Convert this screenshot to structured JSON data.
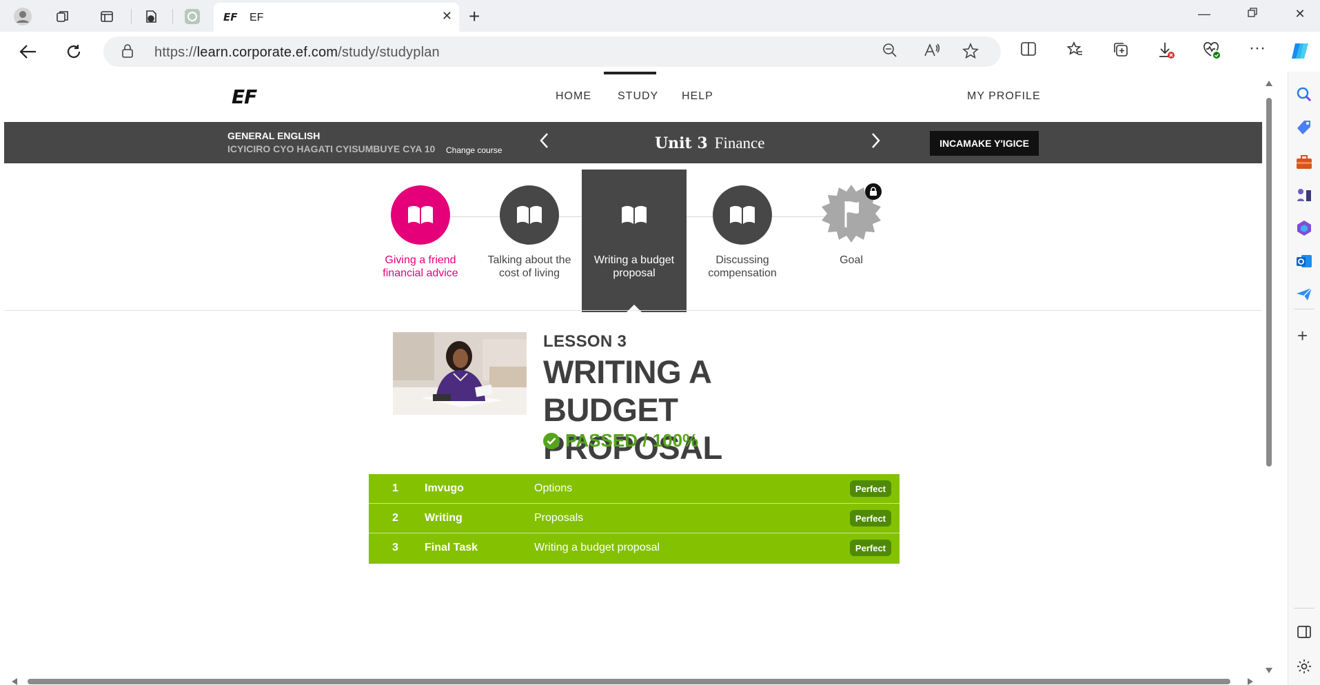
{
  "browser": {
    "tab_title": "EF",
    "tab_favicon_text": "EF",
    "url_scheme": "https://",
    "url_host": "learn.corporate.ef.com",
    "url_path": "/study/studyplan"
  },
  "header": {
    "logo_text": "EF",
    "nav": [
      {
        "label": "HOME",
        "active": false
      },
      {
        "label": "STUDY",
        "active": true
      },
      {
        "label": "HELP",
        "active": false
      }
    ],
    "profile_label": "MY PROFILE"
  },
  "course": {
    "name": "GENERAL ENGLISH",
    "level": "ICYICIRO CYO HAGATI CYISUMBUYE CYA 10",
    "change_label": "Change course",
    "unit_label": "Unit 3",
    "unit_name": "Finance",
    "test_button": "INCAMAKE Y'IGICE"
  },
  "lessons": [
    {
      "label": "Giving a friend financial advice",
      "state": "done"
    },
    {
      "label": "Talking about the cost of living",
      "state": "normal"
    },
    {
      "label": "Writing a budget proposal",
      "state": "active"
    },
    {
      "label": "Discussing compensation",
      "state": "normal"
    },
    {
      "label": "Goal",
      "state": "locked"
    }
  ],
  "lesson": {
    "number_label": "LESSON 3",
    "title": "WRITING A BUDGET PROPOSAL",
    "status": "PASSED / 100%"
  },
  "activities": [
    {
      "num": "1",
      "name": "Imvugo",
      "desc": "Options",
      "score": "Perfect"
    },
    {
      "num": "2",
      "name": "Writing",
      "desc": "Proposals",
      "score": "Perfect"
    },
    {
      "num": "3",
      "name": "Final Task",
      "desc": "Writing a budget proposal",
      "score": "Perfect"
    }
  ],
  "colors": {
    "accent_pink": "#e5007a",
    "pass_green": "#84c100",
    "dark_bar": "#474747"
  }
}
